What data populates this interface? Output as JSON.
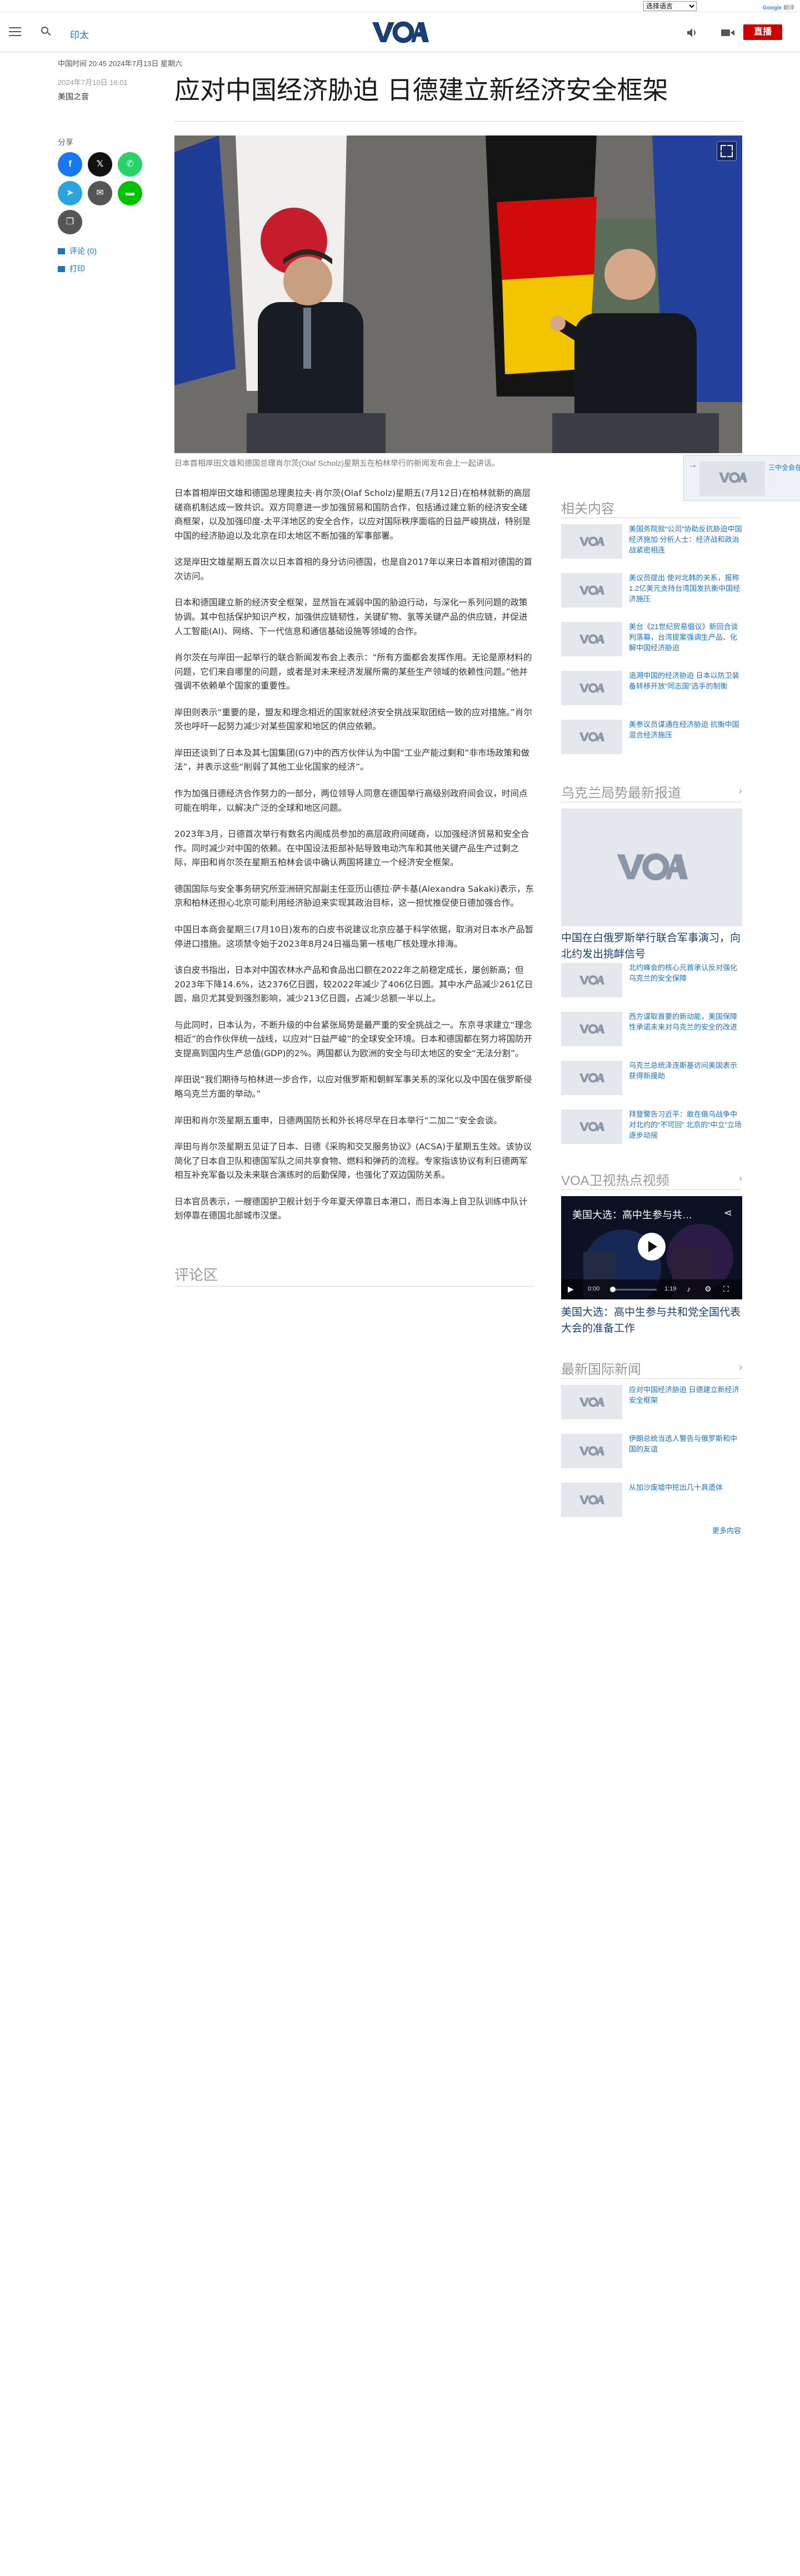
{
  "translate": {
    "select_label": "选择语言",
    "powered_by": "Google",
    "service": "翻译"
  },
  "header": {
    "nav_link": "印太",
    "live_label": "直播"
  },
  "article": {
    "dateline": "中国时间 20:45 2024年7月13日 星期六",
    "pubdate": "2024年7月10日 16:01",
    "author": "美国之音",
    "headline": "应对中国经济胁迫 日德建立新经济安全框架",
    "share_label": "分享",
    "comments_link": "评论 (0)",
    "print_link": "打印",
    "hero_caption": "日本首相岸田文雄和德国总理肖尔茨(Olaf Scholz)星期五在柏林举行的新闻发布会上一起讲话。",
    "paragraphs": [
      "日本首相岸田文雄和德国总理奥拉夫·肖尔茨(Olaf Scholz)星期五(7月12日)在柏林就新的高层磋商机制达成一致共识。双方同意进一步加强贸易和国防合作，包括通过建立新的经济安全磋商框架，以及加强印度-太平洋地区的安全合作，以应对国际秩序面临的日益严峻挑战，特别是中国的经济胁迫以及北京在印太地区不断加强的军事部署。",
      "这是岸田文雄星期五首次以日本首相的身分访问德国，也是自2017年以来日本首相对德国的首次访问。",
      "日本和德国建立新的经济安全框架，显然旨在减弱中国的胁迫行动，与深化一系列问题的政策协调。其中包括保护知识产权，加强供应链韧性，关键矿物、氢等关键产品的供应链，并促进人工智能(AI)、网络、下一代信息和通信基础设施等领域的合作。",
      "肖尔茨在与岸田一起举行的联合新闻发布会上表示：“所有方面都会发挥作用。无论是原材料的问题，它们来自哪里的问题，或者是对未来经济发展所需的某些生产领域的依赖性问题。”他并强调不依赖单个国家的重要性。",
      "岸田则表示“重要的是，盟友和理念相近的国家就经济安全挑战采取团结一致的应对措施。”肖尔茨也呼吁一起努力减少对某些国家和地区的供应依赖。",
      "岸田还谈到了日本及其七国集团(G7)中的西方伙伴认为中国“工业产能过剩和”非市场政策和做法”，并表示这些“削弱了其他工业化国家的经济”。",
      "作为加强日德经济合作努力的一部分，两位领导人同意在德国举行高级别政府间会议，时间点可能在明年，以解决广泛的全球和地区问题。",
      "2023年3月，日德首次举行有数名内阁成员参加的高层政府间磋商，以加强经济贸易和安全合作。同时减少对中国的依赖。在中国设法拒部补贴导致电动汽车和其他关键产品生产过剩之际，岸田和肖尔茨在星期五柏林会谈中确认两国将建立一个经济安全框架。",
      "德国国际与安全事务研究所亚洲研究部副主任亚历山德拉·萨卡基(Alexandra Sakaki)表示，东京和柏林还担心北京可能利用经济胁迫来实现其政治目标，这一担忧推促使日德加强合作。",
      "中国日本商会星期三(7月10日)发布的白皮书说建议北京应基于科学依据，取消对日本水产品暂停进口措施。这项禁令始于2023年8月24日福岛第一核电厂核处理水排海。",
      "该白皮书指出，日本对中国农林水产品和食品出口额在2022年之前稳定成长，屡创新高；但2023年下降14.6%，达2376亿日圆，较2022年减少了406亿日圆。其中水产品减少261亿日圆，扇贝尤其受到强烈影响，减少213亿日圆，占减少总额一半以上。",
      "与此同时，日本认为，不断升级的中台紧张局势是最严重的安全挑战之一。东京寻求建立“理念相近”的合作伙伴统一战线，以应对“日益严峻”的全球安全环境。日本和德国都在努力将国防开支提高到国内生产总值(GDP)的2%。两国都认为欧洲的安全与印太地区的安全“无法分割”。",
      "岸田说“我们期待与柏林进一步合作，以应对俄罗斯和朝鲜军事关系的深化以及中国在俄罗斯侵略乌克兰方面的举动。”",
      "岸田和肖尔茨星期五重申，日德两国防长和外长将尽早在日本举行“二加二”安全会谈。",
      "岸田与肖尔茨星期五见证了日本、日德《采购和交叉服务协议》(ACSA)于星期五生效。该协议简化了日本自卫队和德国军队之间共享食物、燃料和弹药的流程。专家指该协议有利日德两军相互补充军备以及未来联合演练时的后勤保障，也强化了双边国防关系。",
      "日本官员表示，一艘德国护卫舰计划于今年夏天停靠日本港口，而日本海上自卫队训练中队计划停靠在德国北部城市汉堡。"
    ],
    "comments_title": "评论区"
  },
  "floating": {
    "text": "三中全会在即 中国经济之困 北京经济三大难题"
  },
  "sidebar": {
    "related": {
      "title": "相关内容",
      "items": [
        "美国务院就“公司”协助反抗胁迫中国经济施加 分析人士：经济战和政治战紧密相连",
        "美议员提出 使对北韩的关系，报称1.2亿美元支持台湾国发抗衡中国经济施压",
        "美台《21世纪贸易倡议》新回合谈判落幕，台湾提案强调生产品、化解中国经济胁迫",
        "追溯中国的经济胁迫 日本以防卫装备转移开放“同志国”选手的制衡",
        "美参议员谋通在经济胁迫 抗衡中国混合经济施压"
      ]
    },
    "ukraine": {
      "title": "乌克兰局势最新报道",
      "feature_title": "中国在白俄罗斯举行联合军事演习，向北约发出挑衅信号",
      "items": [
        "北约峰会的核心元首承认反对强化乌克兰的安全保障",
        "西方谋取首要的新动能，美国保障性承诺未来对乌克兰的安全的改进",
        "乌克兰总统泽连斯基访问美国表示获得新援助",
        "拜登警告习近平：敢在俄乌战争中对北约的“不可回” 北京的“中立”立场逐步动摇"
      ]
    },
    "video": {
      "title": "VOA卫视热点视频",
      "player_title": "美国大选：高中生参与共…",
      "time_current": "0:00",
      "time_total": "1:19",
      "caption": "美国大选：高中生参与共和党全国代表大会的准备工作"
    },
    "world": {
      "title": "最新国际新闻",
      "items": [
        "应对中国经济胁迫 日德建立新经济安全框架",
        "伊朗总统当选人警告与俄罗斯和中国的友谊",
        "从加沙废墟中挖出几十具遗体"
      ],
      "more_label": "更多内容"
    }
  },
  "colors": {
    "accent": "#1a73c5",
    "live": "#cc0000",
    "brand": "#1a3f73"
  }
}
